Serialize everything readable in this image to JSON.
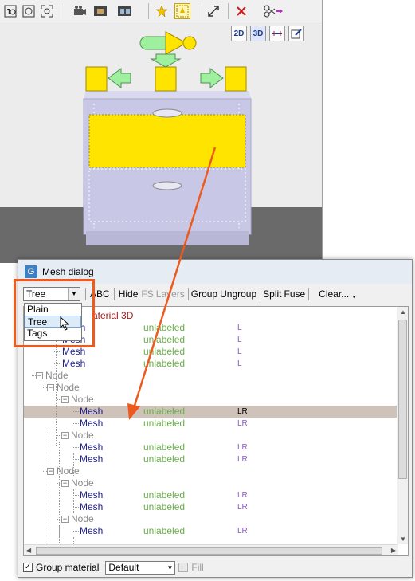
{
  "toolbar": {
    "icons": [
      "scale-icon",
      "zoom-icon",
      "zoom-fit-icon",
      "camera-icon",
      "film-icon",
      "film-strip-icon",
      "star-icon",
      "select-icon",
      "transform-icon",
      "delete-icon",
      "scissors-icon"
    ]
  },
  "viewport": {
    "view_buttons": [
      "2D",
      "3D",
      "",
      ""
    ]
  },
  "dialog": {
    "title": "Mesh dialog",
    "view_select": "Tree",
    "toolbar_labels": [
      "ABC",
      "Hide",
      "FS",
      "Layers",
      "Group",
      "Ungroup",
      "Split",
      "Fuse",
      "Clear..."
    ],
    "dropdown_options": [
      "Plain",
      "Tree",
      "Tags"
    ],
    "root_label": "aterial 3D",
    "rows": [
      {
        "kind": "mesh",
        "label": "Mesh",
        "status": "unlabeled",
        "tag": "L"
      },
      {
        "kind": "mesh",
        "label": "Mesh",
        "status": "unlabeled",
        "tag": "L"
      },
      {
        "kind": "mesh",
        "label": "Mesh",
        "status": "unlabeled",
        "tag": "L"
      },
      {
        "kind": "mesh",
        "label": "Mesh",
        "status": "unlabeled",
        "tag": "L"
      },
      {
        "kind": "node",
        "label": "Node"
      },
      {
        "kind": "node",
        "label": "Node"
      },
      {
        "kind": "node",
        "label": "Node"
      },
      {
        "kind": "mesh",
        "label": "Mesh",
        "status": "unlabeled",
        "tag": "LR",
        "selected": true
      },
      {
        "kind": "mesh",
        "label": "Mesh",
        "status": "unlabeled",
        "tag": "LR"
      },
      {
        "kind": "node",
        "label": "Node"
      },
      {
        "kind": "mesh",
        "label": "Mesh",
        "status": "unlabeled",
        "tag": "LR"
      },
      {
        "kind": "mesh",
        "label": "Mesh",
        "status": "unlabeled",
        "tag": "LR"
      },
      {
        "kind": "node",
        "label": "Node"
      },
      {
        "kind": "node",
        "label": "Node"
      },
      {
        "kind": "mesh",
        "label": "Mesh",
        "status": "unlabeled",
        "tag": "LR"
      },
      {
        "kind": "mesh",
        "label": "Mesh",
        "status": "unlabeled",
        "tag": "LR"
      },
      {
        "kind": "node",
        "label": "Node"
      },
      {
        "kind": "mesh",
        "label": "Mesh",
        "status": "unlabeled",
        "tag": "LR"
      }
    ],
    "bottom": {
      "group_material_label": "Group material",
      "group_material_checked": true,
      "material_select": "Default",
      "fill_label": "Fill"
    }
  },
  "colors": {
    "accent_orange": "#ee5a1d",
    "selection_row": "#cfc2b8",
    "mesh_text": "#202090",
    "status_text": "#6aae4a",
    "tag_text": "#8a5cc0",
    "cabinet": "#c8c8e6",
    "drawer_highlight": "#ffe400"
  }
}
